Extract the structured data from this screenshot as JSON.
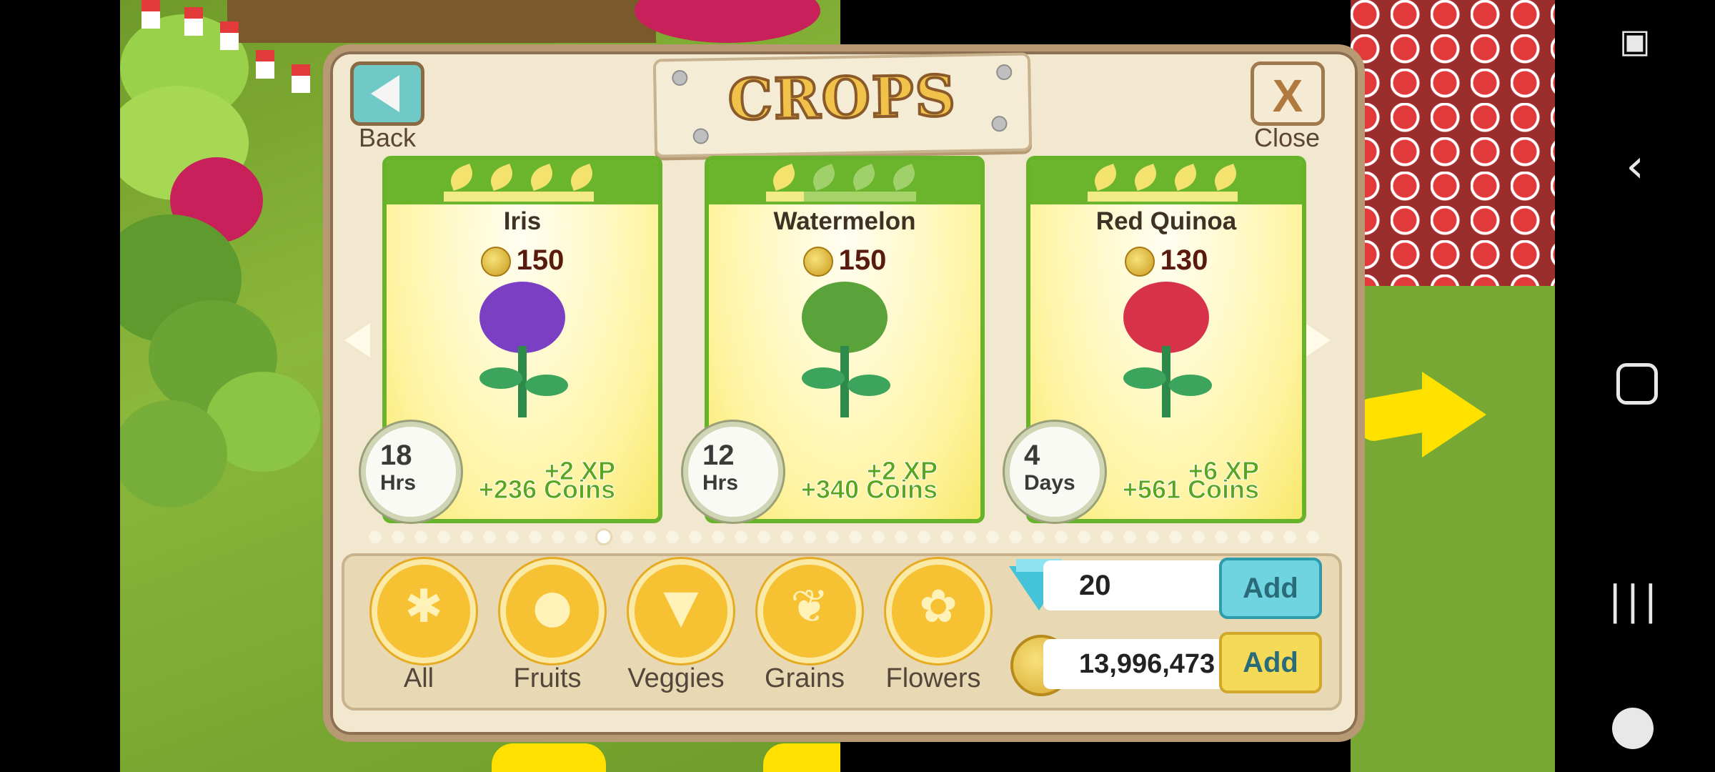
{
  "dialog": {
    "title": "CROPS",
    "back_label": "Back",
    "close_label": "Close"
  },
  "crops": [
    {
      "name": "Iris",
      "price": "150",
      "time_value": "18",
      "time_unit": "Hrs",
      "xp": "+2 XP",
      "coins": "+236 Coins",
      "color": "#7b3fc4"
    },
    {
      "name": "Watermelon",
      "price": "150",
      "time_value": "12",
      "time_unit": "Hrs",
      "xp": "+2 XP",
      "coins": "+340 Coins",
      "color": "#5aa33a"
    },
    {
      "name": "Red Quinoa",
      "price": "130",
      "time_value": "4",
      "time_unit": "Days",
      "xp": "+6 XP",
      "coins": "+561 Coins",
      "color": "#d8324a"
    }
  ],
  "pagination": {
    "total": 42,
    "active": 10
  },
  "categories": [
    {
      "label": "All",
      "icon": "flower-star-icon"
    },
    {
      "label": "Fruits",
      "icon": "orange-icon"
    },
    {
      "label": "Veggies",
      "icon": "carrot-icon"
    },
    {
      "label": "Grains",
      "icon": "wheat-icon"
    },
    {
      "label": "Flowers",
      "icon": "petal-icon"
    }
  ],
  "currency": {
    "gems": "20",
    "coins": "13,996,473",
    "add_label": "Add"
  },
  "colors": {
    "card_green": "#67b32c",
    "gem_add_bg": "#6fd3e0",
    "coin_add_bg": "#f5da58"
  }
}
